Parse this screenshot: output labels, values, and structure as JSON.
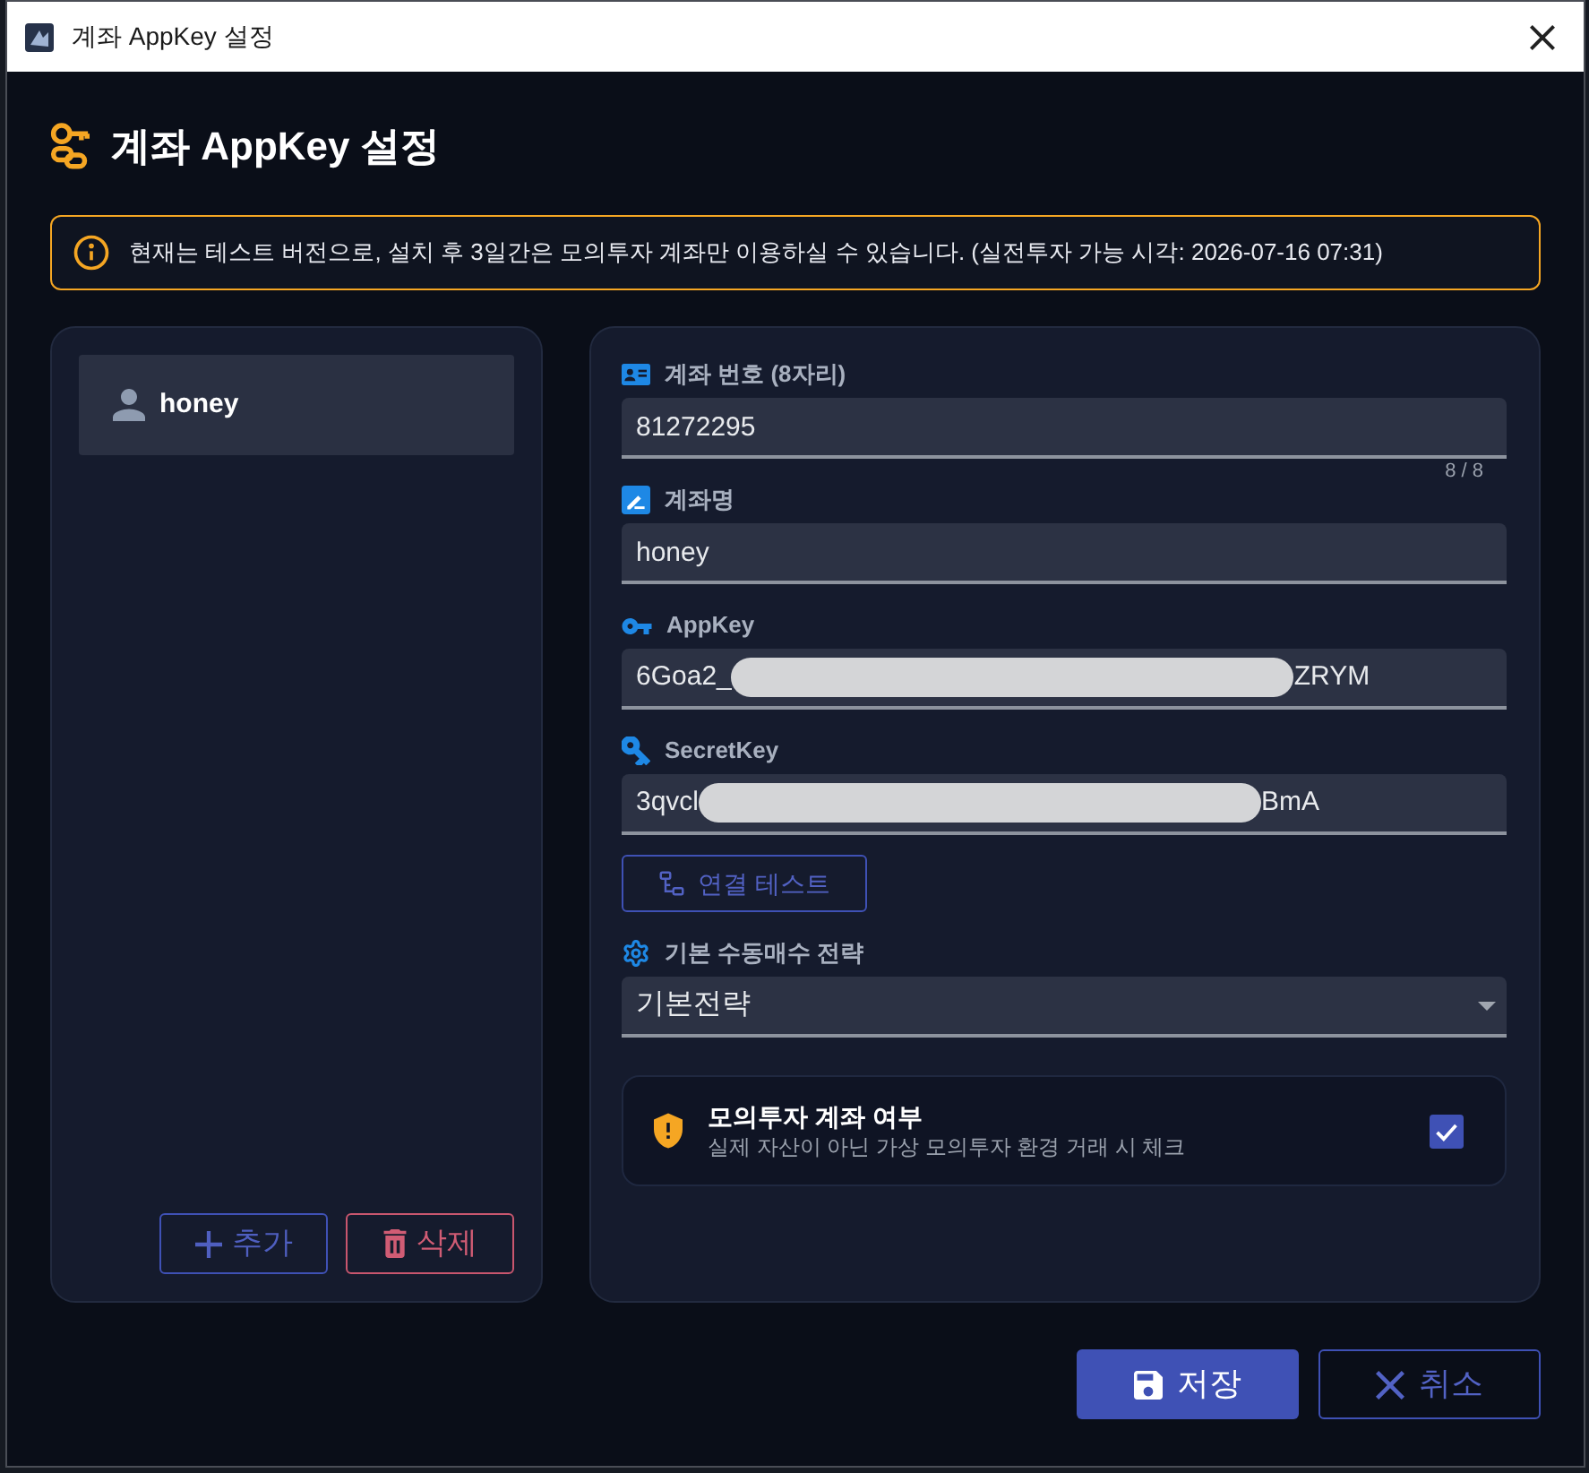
{
  "window": {
    "title": "계좌 AppKey 설정"
  },
  "header": {
    "title": "계좌 AppKey 설정"
  },
  "notice": {
    "text": "현재는 테스트 버전으로, 설치 후 3일간은 모의투자 계좌만 이용하실 수 있습니다. (실전투자 가능 시각: 2026-07-16 07:31)"
  },
  "accounts": {
    "items": [
      {
        "name": "honey",
        "selected": true
      }
    ],
    "buttons": [
      {
        "kind": "add",
        "label": "추가"
      },
      {
        "kind": "delete",
        "label": "삭제"
      }
    ]
  },
  "form": {
    "fields": [
      {
        "kind": "account_number",
        "label": "계좌 번호 (8자리)",
        "value": "81272295",
        "counter": "8 / 8"
      },
      {
        "kind": "account_name",
        "label": "계좌명",
        "value": "honey"
      },
      {
        "kind": "app_key",
        "label": "AppKey",
        "value": "6Goa2_",
        "value_end": "ZRYM",
        "redacted": true
      },
      {
        "kind": "secret_key",
        "label": "SecretKey",
        "value": "3qvcl",
        "value_end": "BmA",
        "redacted": true
      }
    ],
    "test_button": {
      "label": "연결 테스트"
    },
    "strategy": {
      "label": "기본 수동매수 전략",
      "value": "기본전략"
    },
    "mock_account": {
      "title": "모의투자 계좌 여부",
      "description": "실제 자산이 아닌 가상 모의투자 환경 거래 시 체크",
      "checked": true
    }
  },
  "footer": {
    "buttons": [
      {
        "kind": "save",
        "label": "저장"
      },
      {
        "kind": "cancel",
        "label": "취소"
      }
    ]
  }
}
